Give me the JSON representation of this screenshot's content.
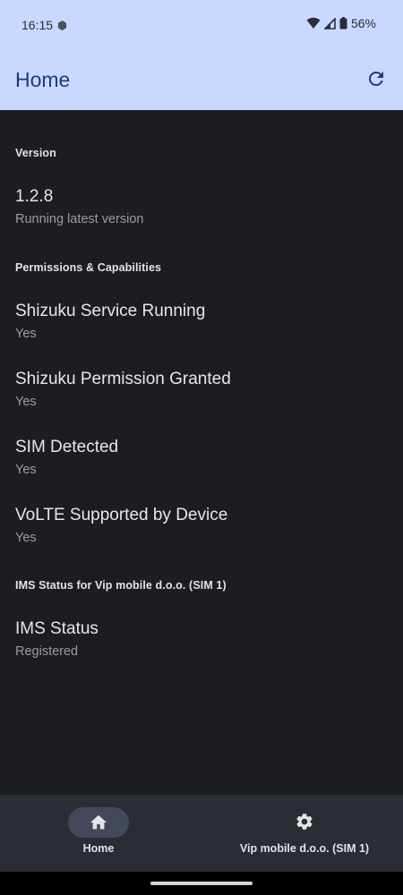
{
  "status_bar": {
    "time": "16:15",
    "battery": "56%"
  },
  "app_bar": {
    "title": "Home"
  },
  "sections": [
    {
      "header": "Version",
      "items": [
        {
          "title": "1.2.8",
          "subtitle": "Running latest version"
        }
      ]
    },
    {
      "header": "Permissions & Capabilities",
      "items": [
        {
          "title": "Shizuku Service Running",
          "subtitle": "Yes"
        },
        {
          "title": "Shizuku Permission Granted",
          "subtitle": "Yes"
        },
        {
          "title": "SIM Detected",
          "subtitle": "Yes"
        },
        {
          "title": "VoLTE Supported by Device",
          "subtitle": "Yes"
        }
      ]
    },
    {
      "header": "IMS Status for Vip mobile d.o.o. (SIM 1)",
      "items": [
        {
          "title": "IMS Status",
          "subtitle": "Registered"
        }
      ]
    }
  ],
  "bottom_nav": {
    "items": [
      {
        "label": "Home",
        "icon": "home-icon",
        "selected": true
      },
      {
        "label": "Vip mobile d.o.o. (SIM 1)",
        "icon": "gear-icon",
        "selected": false
      }
    ]
  },
  "colors": {
    "app_bar_bg": "#c9d8fe",
    "title_color": "#1d3c78",
    "background": "#1c1d22",
    "nav_bg": "#2b2d35",
    "nav_pill": "#43485a"
  }
}
